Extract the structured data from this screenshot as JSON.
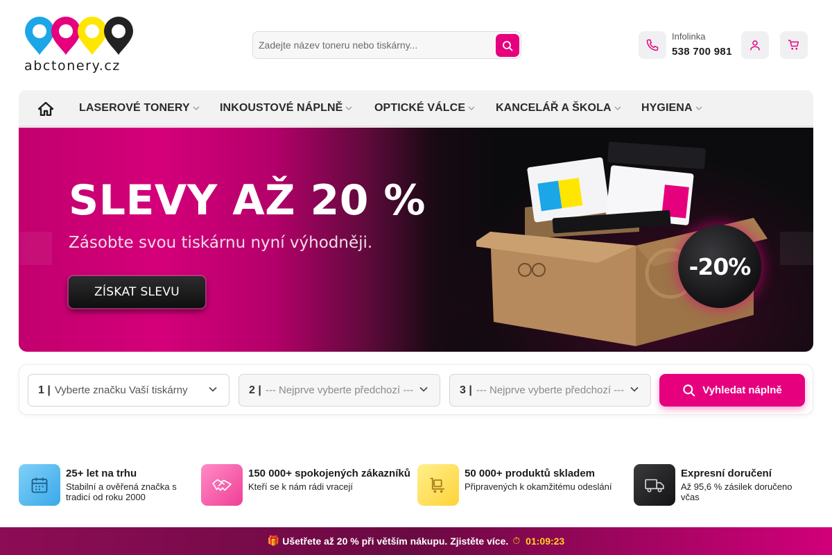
{
  "logo": {
    "text": "abctonery.cz",
    "colors": [
      "#1ba6e8",
      "#e6007e",
      "#ffe600",
      "#222222"
    ]
  },
  "search": {
    "placeholder": "Zadejte název toneru nebo tiskárny...",
    "value": ""
  },
  "hotline": {
    "label": "Infolinka",
    "number": "538 700 981"
  },
  "nav": {
    "items": [
      {
        "label": "LASEROVÉ TONERY"
      },
      {
        "label": "INKOUSTOVÉ NÁPLNĚ"
      },
      {
        "label": "OPTICKÉ VÁLCE"
      },
      {
        "label": "KANCELÁŘ A ŠKOLA"
      },
      {
        "label": "HYGIENA"
      }
    ]
  },
  "banner": {
    "title": "SLEVY AŽ 20 %",
    "subtitle": "Zásobte svou tiskárnu nyní výhodněji.",
    "cta": "ZÍSKAT SLEVU",
    "badge": "-20%"
  },
  "finder": {
    "steps": [
      {
        "num": "1 |",
        "text": "Vyberte značku Vaší tiskárny",
        "disabled": false
      },
      {
        "num": "2 |",
        "text": "--- Nejprve vyberte předchozí ---",
        "disabled": true
      },
      {
        "num": "3 |",
        "text": "--- Nejprve vyberte předchozí ---",
        "disabled": true
      }
    ],
    "button": "Vyhledat náplně"
  },
  "features": [
    {
      "title": "25+ let na trhu",
      "desc": "Stabilní a ověřená značka s tradicí od roku 2000",
      "icon": "calendar-icon",
      "color": "#4fb7f0"
    },
    {
      "title": "150 000+ spokojených zákazníků",
      "desc": "Kteří se k nám rádi vracejí",
      "icon": "handshake-icon",
      "color": "#f05aa6"
    },
    {
      "title": "50 000+ produktů skladem",
      "desc": "Připravených k okamžitému odeslání",
      "icon": "warehouse-cart-icon",
      "color": "#ffe35c"
    },
    {
      "title": "Expresní doručení",
      "desc": "Až 95,6 % zásilek doručeno včas",
      "icon": "truck-icon",
      "color": "#1f1f21"
    }
  ],
  "promo": {
    "icon": "gift-icon",
    "text": "Ušetřete až 20 % při větším nákupu. Zjistěte více.",
    "timer": "01:09:23"
  }
}
